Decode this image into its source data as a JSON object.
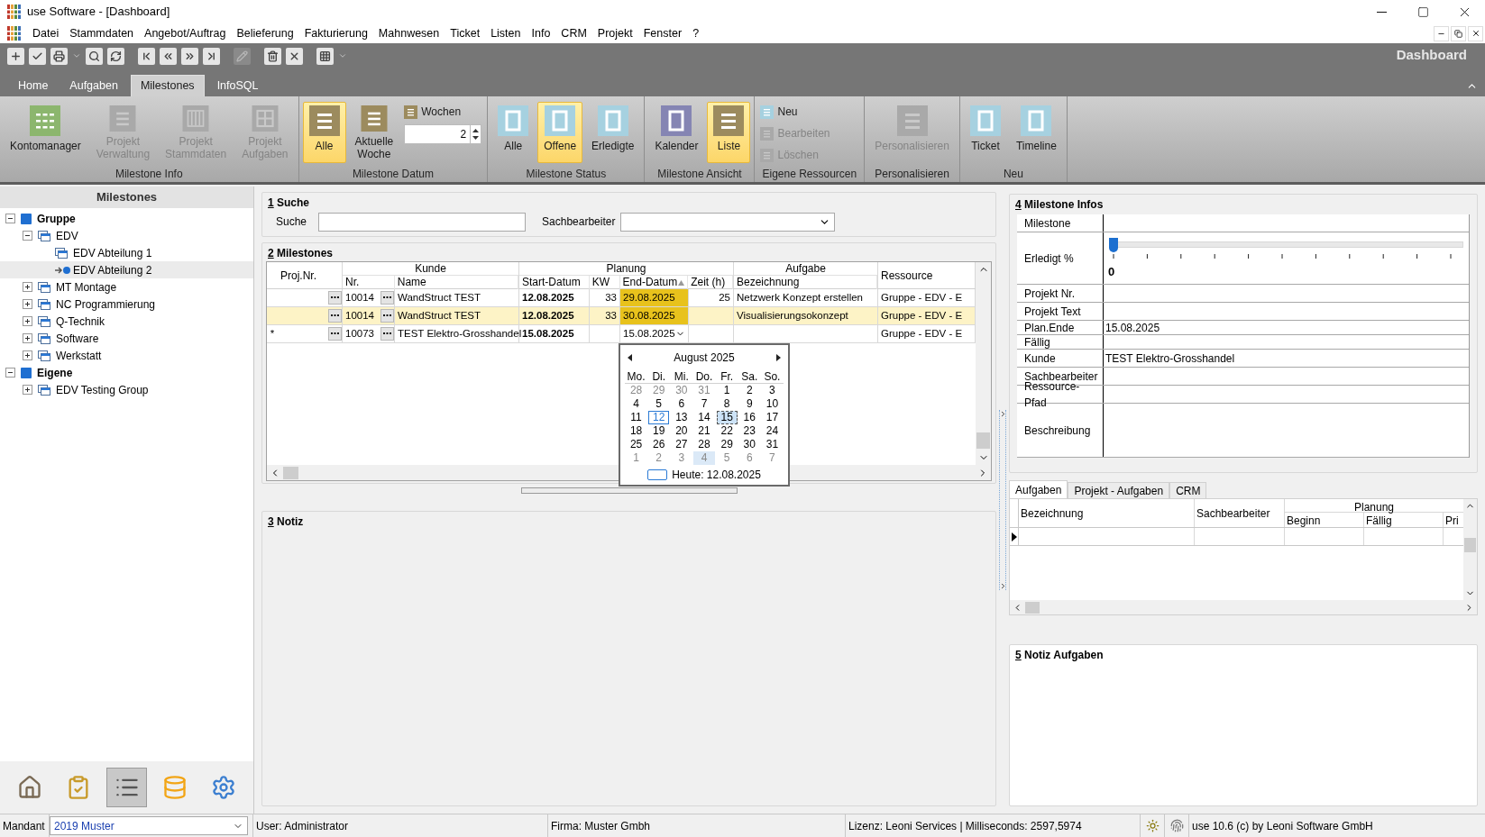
{
  "window": {
    "title": "use Software - [Dashboard]"
  },
  "menu": [
    "Datei",
    "Stammdaten",
    "Angebot/Auftrag",
    "Belieferung",
    "Fakturierung",
    "Mahnwesen",
    "Ticket",
    "Listen",
    "Info",
    "CRM",
    "Projekt",
    "Fenster",
    "?"
  ],
  "toolbar": [
    {
      "kind": "add",
      "disabled": false
    },
    {
      "kind": "save",
      "disabled": false
    },
    {
      "kind": "print",
      "disabled": false
    },
    {
      "kind": "caret",
      "disabled": false
    },
    {
      "kind": "search",
      "disabled": false
    },
    {
      "kind": "refresh",
      "disabled": false
    },
    {
      "kind": "first",
      "disabled": false
    },
    {
      "kind": "prev",
      "disabled": false
    },
    {
      "kind": "next",
      "disabled": false
    },
    {
      "kind": "last",
      "disabled": false
    },
    {
      "kind": "edit",
      "disabled": true
    },
    {
      "kind": "delete",
      "disabled": false
    },
    {
      "kind": "cancel",
      "disabled": false
    },
    {
      "kind": "grid",
      "disabled": false
    },
    {
      "kind": "caret",
      "disabled": false
    }
  ],
  "page_title": "Dashboard",
  "ribbon_tabs": [
    {
      "label": "Home",
      "selected": false
    },
    {
      "label": "Aufgaben",
      "selected": false
    },
    {
      "label": "Milestones",
      "selected": true
    },
    {
      "label": "InfoSQL",
      "selected": false
    }
  ],
  "ribbon_groups": [
    {
      "label": "Milestone Info",
      "items": [
        {
          "kind": "grid",
          "label": "Kontomanager",
          "color": "#8cb66e",
          "disabled": false,
          "selected": false
        },
        {
          "kind": "lines",
          "label": "Projekt\nVerwaltung",
          "color": "#a9a9a9",
          "disabled": true,
          "selected": false
        },
        {
          "kind": "columns",
          "label": "Projekt\nStammdaten",
          "color": "#a9a9a9",
          "disabled": true,
          "selected": false
        },
        {
          "kind": "tiles",
          "label": "Projekt\nAufgaben",
          "color": "#a9a9a9",
          "disabled": true,
          "selected": false
        }
      ]
    },
    {
      "label": "Milestone Datum",
      "items": [
        {
          "kind": "lines",
          "label": "Alle",
          "color": "#9c8b5e",
          "disabled": false,
          "selected": true
        },
        {
          "kind": "lines",
          "label": "Aktuelle\nWoche",
          "color": "#9c8b5e",
          "disabled": false,
          "selected": false
        },
        {
          "kind": "small",
          "label": "Wochen",
          "color": "#9c8b5e",
          "disabled": false
        },
        {
          "kind": "spinner",
          "value": "2"
        }
      ]
    },
    {
      "label": "Milestone Status",
      "items": [
        {
          "kind": "frame",
          "label": "Alle",
          "color": "#a6d1e0",
          "disabled": false,
          "selected": false
        },
        {
          "kind": "frame",
          "label": "Offene",
          "color": "#a6d1e0",
          "disabled": false,
          "selected": true
        },
        {
          "kind": "frame",
          "label": "Erledigte",
          "color": "#a6d1e0",
          "disabled": false,
          "selected": false
        }
      ]
    },
    {
      "label": "Milestone Ansicht",
      "items": [
        {
          "kind": "frame",
          "label": "Kalender",
          "color": "#8585b3",
          "disabled": false,
          "selected": false
        },
        {
          "kind": "lines",
          "label": "Liste",
          "color": "#9c8b5e",
          "disabled": false,
          "selected": true
        }
      ]
    },
    {
      "label": "Eigene Ressourcen",
      "items": [
        {
          "kind": "small",
          "label": "Neu",
          "color": "#a6d1e0",
          "disabled": false
        },
        {
          "kind": "small",
          "label": "Bearbeiten",
          "color": "#a9a9a9",
          "disabled": true
        },
        {
          "kind": "small",
          "label": "Löschen",
          "color": "#a9a9a9",
          "disabled": true
        }
      ]
    },
    {
      "label": "Personalisieren",
      "items": [
        {
          "kind": "lines",
          "label": "Personalisieren",
          "color": "#a9a9a9",
          "disabled": true,
          "selected": false
        }
      ]
    },
    {
      "label": "Neu",
      "items": [
        {
          "kind": "frame",
          "label": "Ticket",
          "color": "#a6d1e0",
          "disabled": false,
          "selected": false
        },
        {
          "kind": "frame",
          "label": "Timeline",
          "color": "#a6d1e0",
          "disabled": false,
          "selected": false
        }
      ]
    }
  ],
  "left_panel": {
    "title": "Milestones",
    "tree": [
      {
        "label": "Gruppe",
        "kind": "group",
        "expanded": true,
        "selected": false,
        "children": [
          {
            "label": "EDV",
            "kind": "unit",
            "expanded": true,
            "selected": false,
            "children": [
              {
                "label": "EDV Abteilung 1",
                "kind": "unit",
                "selected": false
              },
              {
                "label": "EDV Abteilung 2",
                "kind": "unit",
                "selected": true
              }
            ]
          },
          {
            "label": "MT Montage",
            "kind": "unit",
            "expanded": false,
            "selected": false
          },
          {
            "label": "NC Programmierung",
            "kind": "unit",
            "expanded": false,
            "selected": false
          },
          {
            "label": "Q-Technik",
            "kind": "unit",
            "expanded": false,
            "selected": false
          },
          {
            "label": "Software",
            "kind": "unit",
            "expanded": false,
            "selected": false
          },
          {
            "label": "Werkstatt",
            "kind": "unit",
            "expanded": false,
            "selected": false
          }
        ]
      },
      {
        "label": "Eigene",
        "kind": "group",
        "expanded": true,
        "selected": false,
        "children": [
          {
            "label": "EDV Testing Group",
            "kind": "unit",
            "expanded": false,
            "selected": false
          }
        ]
      }
    ],
    "nav": [
      {
        "kind": "home",
        "selected": false
      },
      {
        "kind": "tasks",
        "selected": false
      },
      {
        "kind": "list",
        "selected": true
      },
      {
        "kind": "database",
        "selected": false
      },
      {
        "kind": "settings",
        "selected": false
      }
    ]
  },
  "search_section": {
    "number": "1",
    "title": "Suche",
    "search_label": "Suche",
    "clerk_label": "Sachbearbeiter"
  },
  "milestones_section": {
    "number": "2",
    "title": "Milestones",
    "headers": [
      {
        "kind": "single",
        "label": "Proj.Nr."
      },
      {
        "kind": "group",
        "label": "Kunde",
        "columns": [
          {
            "label": "Nr.",
            "sorted": false
          },
          {
            "label": "Name",
            "sorted": false
          }
        ]
      },
      {
        "kind": "group",
        "label": "Planung",
        "columns": [
          {
            "label": "Start-Datum",
            "sorted": false
          },
          {
            "label": "KW",
            "sorted": false
          },
          {
            "label": "End-Datum",
            "sorted": true
          },
          {
            "label": "Zeit (h)",
            "sorted": false
          }
        ]
      },
      {
        "kind": "group",
        "label": "Aufgabe",
        "columns": [
          {
            "label": "Bezeichnung",
            "sorted": false
          }
        ]
      },
      {
        "kind": "single",
        "label": "Ressource"
      }
    ],
    "rows": [
      {
        "selected": false,
        "editing": false,
        "end_highlight": true,
        "nr": "10014",
        "name": "WandStruct TEST",
        "start": "12.08.2025",
        "kw": "33",
        "end": "29.08.2025",
        "zeit": "25",
        "bezeichnung": "Netzwerk Konzept erstellen",
        "ressource": "Gruppe - EDV - E"
      },
      {
        "selected": true,
        "editing": false,
        "end_highlight": true,
        "nr": "10014",
        "name": "WandStruct TEST",
        "start": "12.08.2025",
        "kw": "33",
        "end": "30.08.2025",
        "bezeichnung": "Visualisierungsokonzept",
        "ressource": "Gruppe - EDV - E"
      },
      {
        "selected": false,
        "editing": true,
        "end_highlight": false,
        "marker": "*",
        "nr": "10073",
        "name": "TEST Elektro-Grosshandel",
        "start": "15.08.2025",
        "end": "15.08.2025",
        "ressource": "Gruppe - EDV - E"
      }
    ],
    "calendar": {
      "month": "August 2025",
      "weekdays": [
        "Mo.",
        "Di.",
        "Mi.",
        "Do.",
        "Fr.",
        "Sa.",
        "So."
      ],
      "today_label": "Heute: 12.08.2025",
      "weeks": [
        [
          {
            "d": "28",
            "muted": true,
            "today": false,
            "selected": false,
            "hot": false
          },
          {
            "d": "29",
            "muted": true,
            "today": false,
            "selected": false,
            "hot": false
          },
          {
            "d": "30",
            "muted": true,
            "today": false,
            "selected": false,
            "hot": false
          },
          {
            "d": "31",
            "muted": true,
            "today": false,
            "selected": false,
            "hot": false
          },
          {
            "d": "1",
            "muted": false,
            "today": false,
            "selected": false,
            "hot": false
          },
          {
            "d": "2",
            "muted": false,
            "today": false,
            "selected": false,
            "hot": false
          },
          {
            "d": "3",
            "muted": false,
            "today": false,
            "selected": false,
            "hot": false
          }
        ],
        [
          {
            "d": "4",
            "muted": false,
            "today": false,
            "selected": false,
            "hot": false
          },
          {
            "d": "5",
            "muted": false,
            "today": false,
            "selected": false,
            "hot": false
          },
          {
            "d": "6",
            "muted": false,
            "today": false,
            "selected": false,
            "hot": false
          },
          {
            "d": "7",
            "muted": false,
            "today": false,
            "selected": false,
            "hot": false
          },
          {
            "d": "8",
            "muted": false,
            "today": false,
            "selected": false,
            "hot": false
          },
          {
            "d": "9",
            "muted": false,
            "today": false,
            "selected": false,
            "hot": false
          },
          {
            "d": "10",
            "muted": false,
            "today": false,
            "selected": false,
            "hot": false
          }
        ],
        [
          {
            "d": "11",
            "muted": false,
            "today": false,
            "selected": false,
            "hot": false
          },
          {
            "d": "12",
            "muted": false,
            "today": true,
            "selected": false,
            "hot": false
          },
          {
            "d": "13",
            "muted": false,
            "today": false,
            "selected": false,
            "hot": false
          },
          {
            "d": "14",
            "muted": false,
            "today": false,
            "selected": false,
            "hot": false
          },
          {
            "d": "15",
            "muted": false,
            "today": false,
            "selected": true,
            "hot": false
          },
          {
            "d": "16",
            "muted": false,
            "today": false,
            "selected": false,
            "hot": false
          },
          {
            "d": "17",
            "muted": false,
            "today": false,
            "selected": false,
            "hot": false
          }
        ],
        [
          {
            "d": "18",
            "muted": false,
            "today": false,
            "selected": false,
            "hot": false
          },
          {
            "d": "19",
            "muted": false,
            "today": false,
            "selected": false,
            "hot": false
          },
          {
            "d": "20",
            "muted": false,
            "today": false,
            "selected": false,
            "hot": false
          },
          {
            "d": "21",
            "muted": false,
            "today": false,
            "selected": false,
            "hot": false
          },
          {
            "d": "22",
            "muted": false,
            "today": false,
            "selected": false,
            "hot": false
          },
          {
            "d": "23",
            "muted": false,
            "today": false,
            "selected": false,
            "hot": false
          },
          {
            "d": "24",
            "muted": false,
            "today": false,
            "selected": false,
            "hot": false
          }
        ],
        [
          {
            "d": "25",
            "muted": false,
            "today": false,
            "selected": false,
            "hot": false
          },
          {
            "d": "26",
            "muted": false,
            "today": false,
            "selected": false,
            "hot": false
          },
          {
            "d": "27",
            "muted": false,
            "today": false,
            "selected": false,
            "hot": false
          },
          {
            "d": "28",
            "muted": false,
            "today": false,
            "selected": false,
            "hot": false
          },
          {
            "d": "29",
            "muted": false,
            "today": false,
            "selected": false,
            "hot": false
          },
          {
            "d": "30",
            "muted": false,
            "today": false,
            "selected": false,
            "hot": false
          },
          {
            "d": "31",
            "muted": false,
            "today": false,
            "selected": false,
            "hot": false
          }
        ],
        [
          {
            "d": "1",
            "muted": true,
            "today": false,
            "selected": false,
            "hot": false
          },
          {
            "d": "2",
            "muted": true,
            "today": false,
            "selected": false,
            "hot": false
          },
          {
            "d": "3",
            "muted": true,
            "today": false,
            "selected": false,
            "hot": false
          },
          {
            "d": "4",
            "muted": true,
            "today": false,
            "selected": false,
            "hot": true
          },
          {
            "d": "5",
            "muted": true,
            "today": false,
            "selected": false,
            "hot": false
          },
          {
            "d": "6",
            "muted": true,
            "today": false,
            "selected": false,
            "hot": false
          },
          {
            "d": "7",
            "muted": true,
            "today": false,
            "selected": false,
            "hot": false
          }
        ]
      ]
    }
  },
  "notes_section": {
    "number": "3",
    "title": "Notiz"
  },
  "info_section": {
    "number": "4",
    "title": "Milestone Infos",
    "rows": [
      {
        "kind": "text",
        "label": "Milestone"
      },
      {
        "kind": "slider",
        "label": "Erledigt %",
        "level": 0,
        "value": "0"
      },
      {
        "kind": "text",
        "label": "Projekt Nr."
      },
      {
        "kind": "text",
        "label": "Projekt Text"
      },
      {
        "kind": "compact",
        "label": "Plan.Ende",
        "value": "15.08.2025"
      },
      {
        "kind": "compact",
        "label": "Fällig"
      },
      {
        "kind": "text",
        "label": "Kunde",
        "value": "TEST Elektro-Grosshandel"
      },
      {
        "kind": "text",
        "label": "Sachbearbeiter"
      },
      {
        "kind": "text",
        "label": "Ressource-Pfad"
      },
      {
        "kind": "tall",
        "label": "Beschreibung"
      }
    ]
  },
  "detail_tabs": [
    {
      "label": "Aufgaben",
      "selected": true
    },
    {
      "label": "Projekt - Aufgaben",
      "selected": false
    },
    {
      "label": "CRM",
      "selected": false
    }
  ],
  "tasks_grid": {
    "headers": [
      {
        "kind": "single",
        "label": "Bezeichnung"
      },
      {
        "kind": "single",
        "label": "Sachbearbeiter"
      },
      {
        "kind": "group",
        "label": "Planung",
        "columns": [
          {
            "label": "Beginn"
          },
          {
            "label": "Fällig"
          },
          {
            "label": "Pri"
          }
        ]
      }
    ]
  },
  "task_notes_section": {
    "number": "5",
    "title": "Notiz Aufgaben"
  },
  "status_bar": {
    "mandant_label": "Mandant",
    "mandant": "2019 Muster",
    "user": "User: Administrator",
    "company": "Firma: Muster Gmbh",
    "license": "Lizenz: Leoni Services | Milliseconds: 2597,5974",
    "version": "use 10.6 (c) by Leoni Software GmbH"
  }
}
